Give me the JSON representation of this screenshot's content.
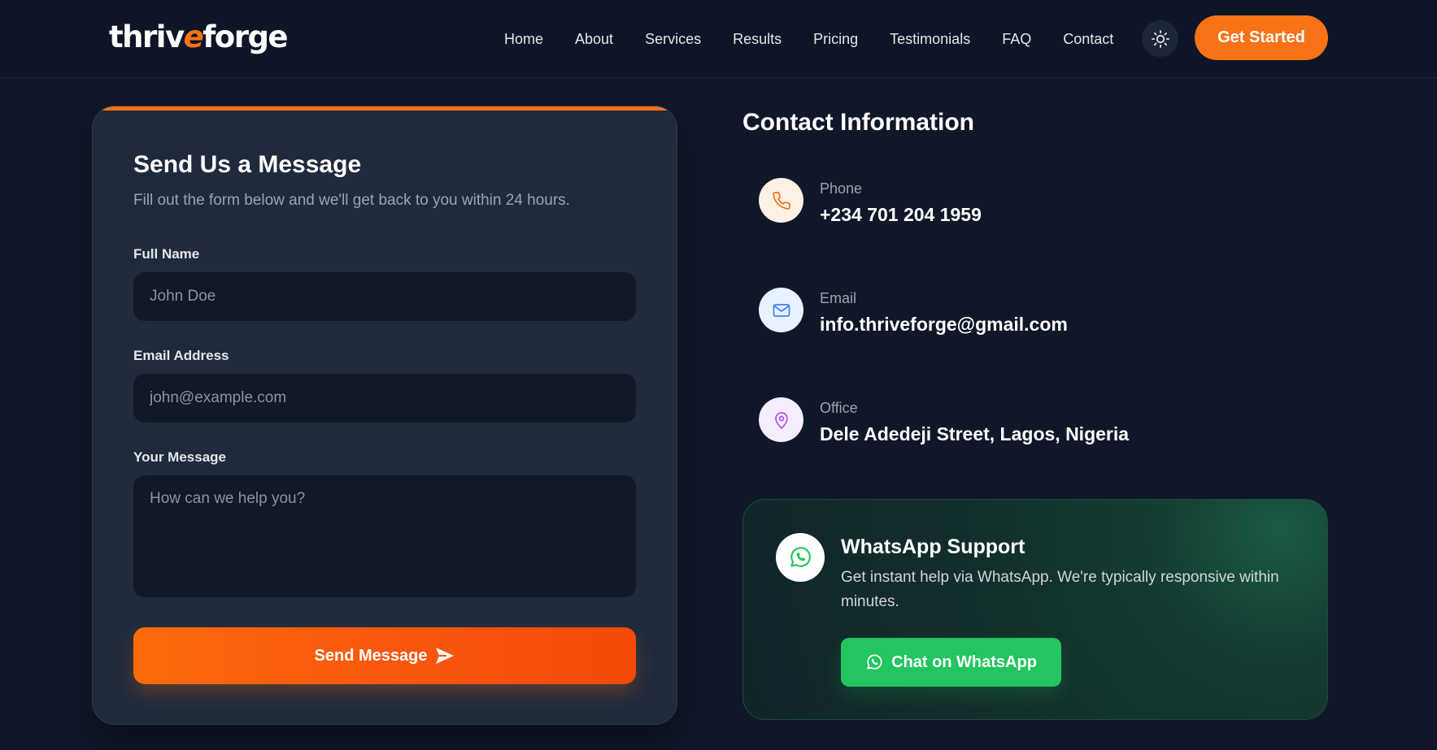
{
  "brand": {
    "logo_part1": "thriv",
    "logo_accent": "e",
    "logo_part2": "forge"
  },
  "nav": {
    "links": [
      "Home",
      "About",
      "Services",
      "Results",
      "Pricing",
      "Testimonials",
      "FAQ",
      "Contact"
    ],
    "theme_toggle_icon": "sun-icon",
    "cta_label": "Get Started"
  },
  "form": {
    "title": "Send Us a Message",
    "subtitle": "Fill out the form below and we'll get back to you within 24 hours.",
    "full_name": {
      "label": "Full Name",
      "placeholder": "John Doe",
      "value": ""
    },
    "email": {
      "label": "Email Address",
      "placeholder": "john@example.com",
      "value": ""
    },
    "message": {
      "label": "Your Message",
      "placeholder": "How can we help you?",
      "value": ""
    },
    "submit_label": "Send Message",
    "submit_icon": "send-icon"
  },
  "contact": {
    "title": "Contact Information",
    "items": [
      {
        "label": "Phone",
        "value": "+234 701 204 1959",
        "icon": "phone-icon",
        "color": "#f97316"
      },
      {
        "label": "Email",
        "value": "info.thriveforge@gmail.com",
        "icon": "mail-icon",
        "color": "#3b82f6"
      },
      {
        "label": "Office",
        "value": "Dele Adedeji Street, Lagos, Nigeria",
        "icon": "map-pin-icon",
        "color": "#a855f7"
      }
    ]
  },
  "whatsapp": {
    "title": "WhatsApp Support",
    "description": "Get instant help via WhatsApp. We're typically responsive within minutes.",
    "button_label": "Chat on WhatsApp",
    "icon": "whatsapp-icon"
  },
  "colors": {
    "accent": "#f97316",
    "background": "#0f1729",
    "card": "#1f2a3c",
    "whatsapp": "#22c55e"
  }
}
